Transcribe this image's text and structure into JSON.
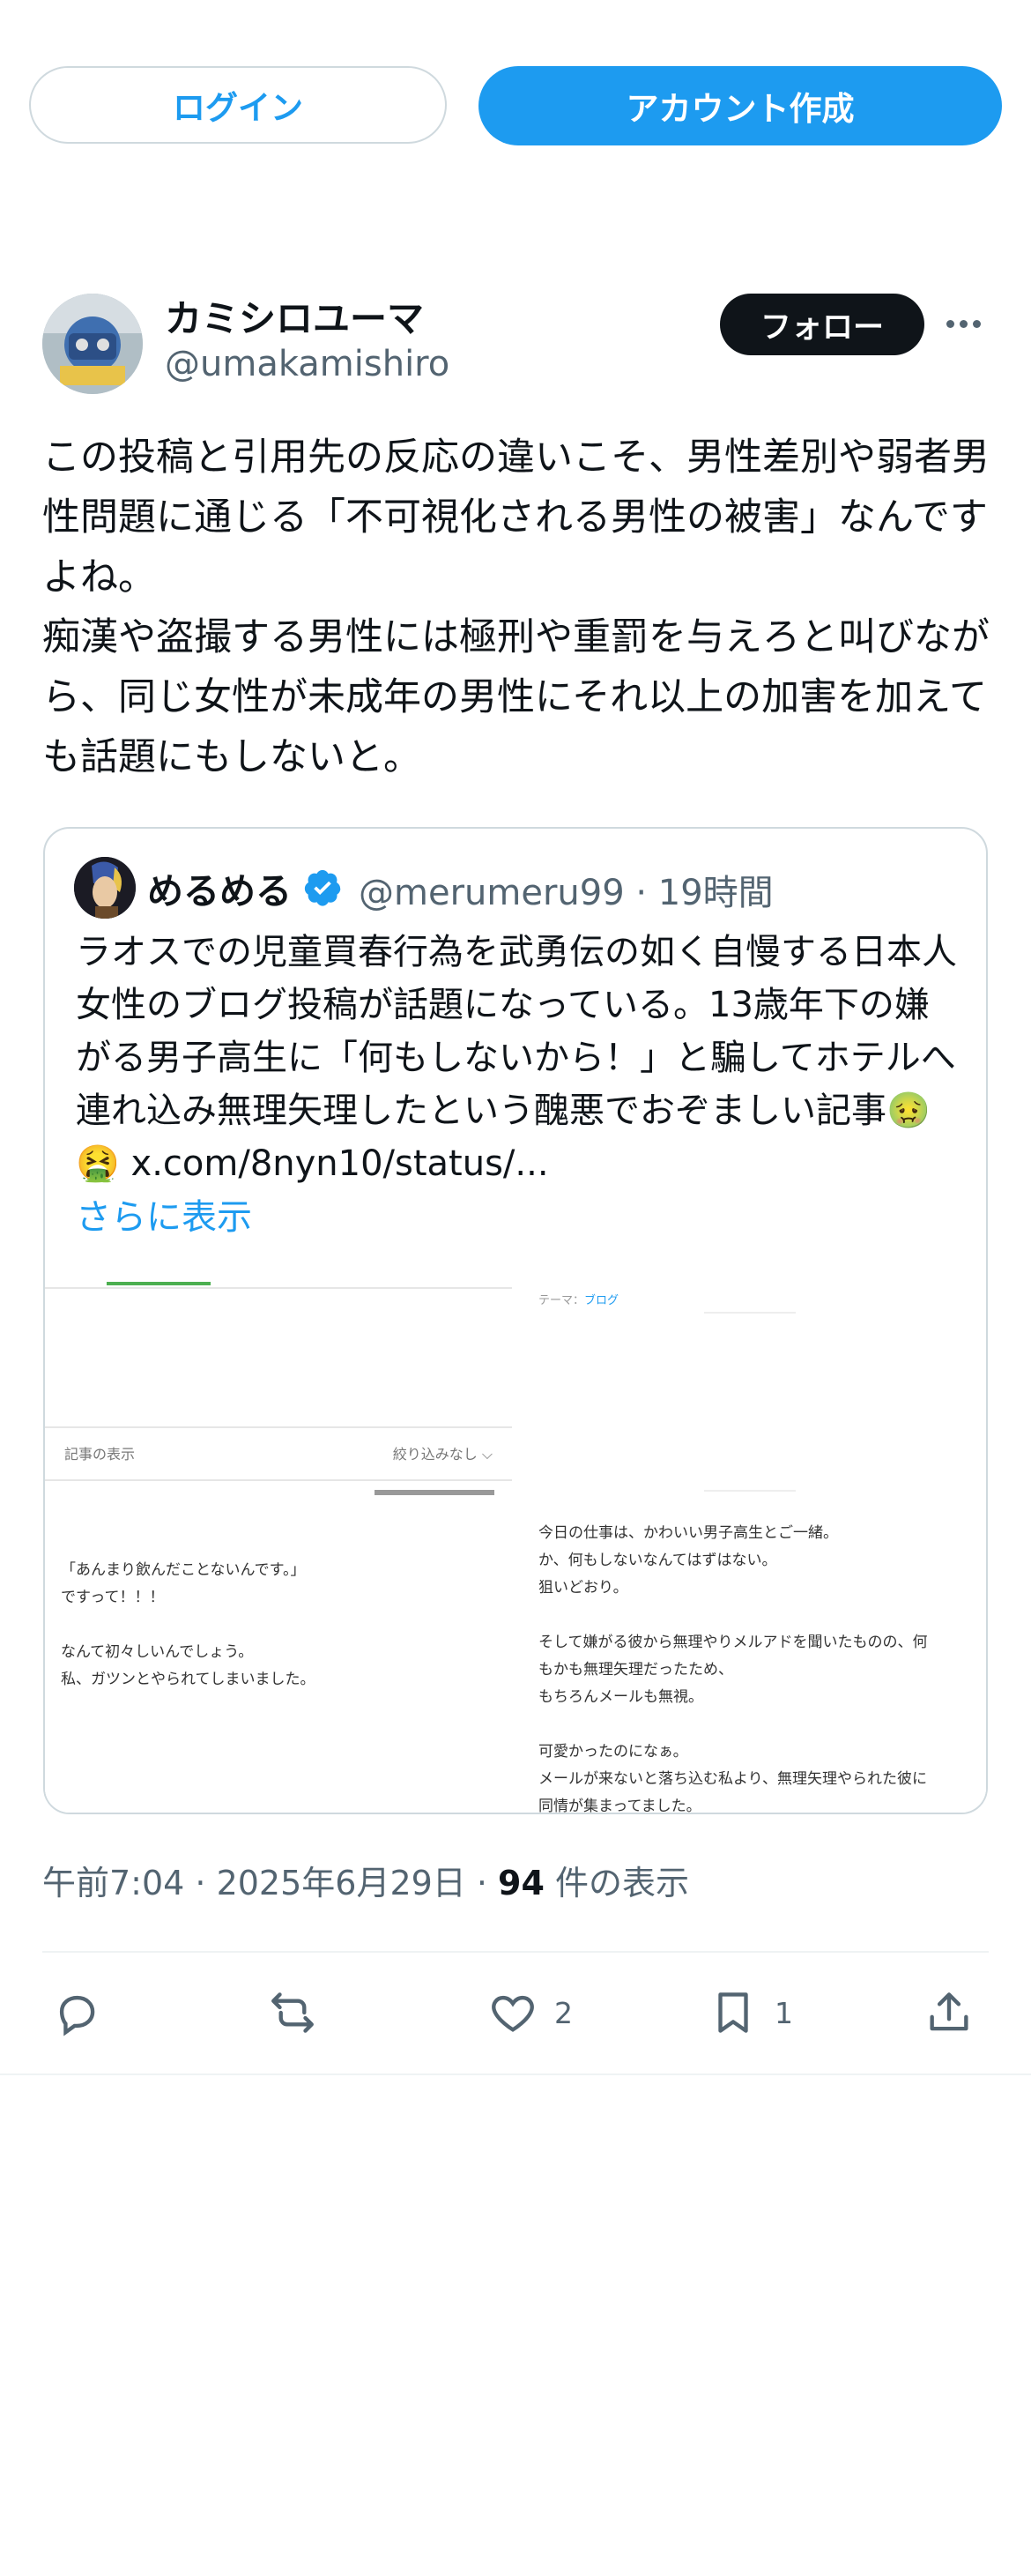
{
  "top_buttons": {
    "login": "ログイン",
    "signup": "アカウント作成"
  },
  "tweet": {
    "author_name": "カミシロユーマ",
    "author_handle": "@umakamishiro",
    "follow_label": "フォロー",
    "text": "この投稿と引用先の反応の違いこそ、男性差別や弱者男性問題に通じる「不可視化される男性の被害」なんですよね。\n痴漢や盗撮する男性には極刑や重罰を与えろと叫びながら、同じ女性が未成年の男性にそれ以上の加害を加えても話題にもしないと。",
    "meta": {
      "time": "午前7:04 · 2025年6月29日 · ",
      "views": "94",
      "views_label": " 件の表示"
    },
    "actions": {
      "likes": "2",
      "bookmarks": "1"
    }
  },
  "quote": {
    "name": "めるめる",
    "handle": "@merumeru99 · 19時間",
    "text": "ラオスでの児童買春行為を武勇伝の如く自慢する日本人女性のブログ投稿が話題になっている。13歳年下の嫌がる男子高生に「何もしないから！」と騙してホテルへ連れ込み無理矢理したという醜悪でおぞましい記事🤢🤮 ",
    "link": "x.com/8nyn10/status/...",
    "show_more": "さらに表示",
    "image_left": {
      "filter_label": "記事の表示",
      "filter_right": "絞り込みなし ⌵",
      "body": "「あんまり飲んだことないんです。」\nですって！！！\n\nなんて初々しいんでしょう。\n私、ガツンとやられてしまいました。"
    },
    "image_right": {
      "theme_prefix": "テーマ：",
      "theme_value": "ブログ",
      "body": "今日の仕事は、かわいい男子高生とご一緒。\nか、何もしないなんてはずはない。\n狙いどおり。\n\nそして嫌がる彼から無理やりメルアドを聞いたものの、何\nもかも無理矢理だったため、\nもちろんメールも無視。\n\n可愛かったのになぁ。\nメールが来ないと落ち込む私より、無理矢理やられた彼に\n同情が集まってました。"
    }
  },
  "colors": {
    "accent": "#1d9bf0",
    "text": "#0f1419",
    "muted": "#536471"
  }
}
